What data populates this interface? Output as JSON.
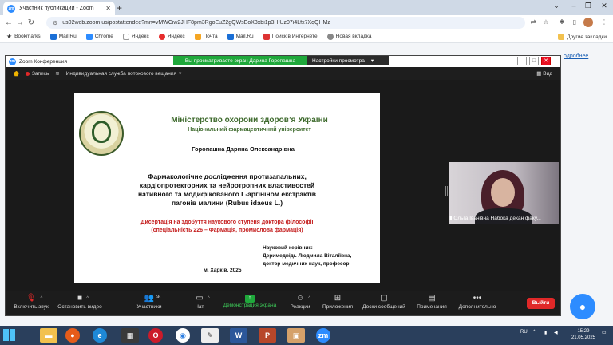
{
  "browser": {
    "tab_title": "Участник публикации - Zoom",
    "url": "us02web.zoom.us/postattendee?mn=vMWCiw2JHF8pm3RgoEuZ2gQWsEoX3xbi1p3H.Uz07i4Lfx7XqQHMz",
    "bookmarks": [
      "Bookmarks",
      "Mail.Ru",
      "Chrome",
      "Яндекс",
      "Яндекс",
      "Почта",
      "Mail.Ru",
      "Поиск в Интернете",
      "Новая вкладка"
    ],
    "other_bookmarks": "Другие закладки"
  },
  "page_background": {
    "link_fragment": "одробнее"
  },
  "zoom": {
    "window_title": "Zoom Конференция",
    "share_banner": "Вы просматриваете экран Дарина Горопашна",
    "view_options": "Настройки просмотра",
    "recording": "Запись",
    "streaming_service": "Индивидуальная служба потокового вещания",
    "view_button": "Вид",
    "participant_name": "Ольга Іванівна Набока декан факу...",
    "participants_count": "9",
    "toolbar": {
      "mute": "Включить звук",
      "video": "Остановить видео",
      "participants": "Участники",
      "chat": "Чат",
      "share": "Демонстрация экрана",
      "reactions": "Реакции",
      "apps": "Приложения",
      "whiteboards": "Доски сообщений",
      "notes": "Примечания",
      "more": "Дополнительно",
      "leave": "Выйти"
    }
  },
  "slide": {
    "ministry": "Міністерство охорони здоров’я України",
    "university": "Національний фармацевтичний університет",
    "author": "Горопашна Дарина Олександрівна",
    "title_lines": [
      "Фармакологічне дослідження протизапальних,",
      "кардіопротекторних та нейротропних властивостей",
      "нативного та модифікованого L-аргініном екстрактів",
      "пагонів малини (Rubus idaeus L.)"
    ],
    "degree_lines": [
      "Дисертація на здобуття наукового ступеня доктора філософії",
      "(спеціальність 226 – Фармація, промислова фармація)"
    ],
    "supervisor_label": "Науковий керівник:",
    "supervisor_name": "Деримедвідь Людмила Віталіївна,",
    "supervisor_title": "доктор медичних наук, професор",
    "place_year": "м. Харків, 2025",
    "colors": {
      "green": "#3f6b2e",
      "red": "#c41e1e",
      "text": "#111111"
    }
  },
  "taskbar": {
    "lang": "RU",
    "time": "15:29",
    "date": "21.05.2025"
  }
}
